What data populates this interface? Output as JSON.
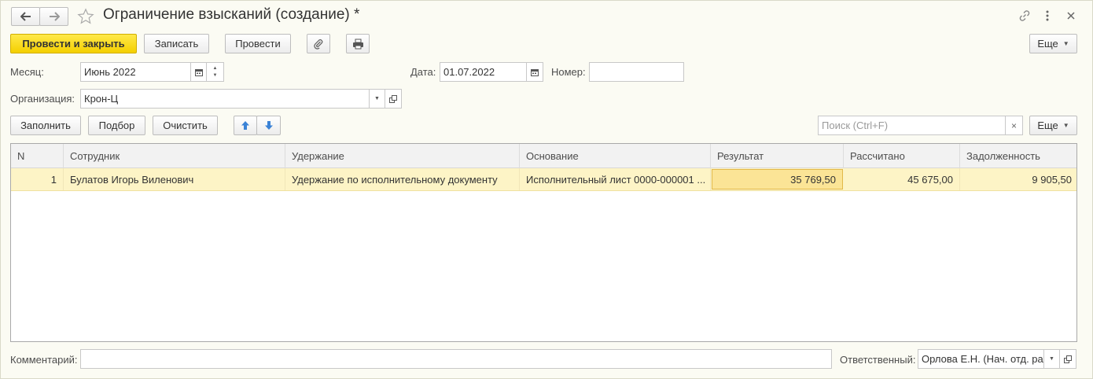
{
  "window": {
    "title": "Ограничение взысканий (создание) *",
    "back_icon": "arrow-left-icon",
    "forward_icon": "arrow-right-icon",
    "favorite_icon": "star-icon",
    "link_icon": "link-icon",
    "menu_icon": "more-vertical-icon",
    "close_icon": "close-icon"
  },
  "toolbar": {
    "post_close": "Провести и закрыть",
    "save": "Записать",
    "post": "Провести",
    "attach_icon": "paperclip-icon",
    "print_icon": "printer-icon",
    "more": "Еще"
  },
  "form": {
    "month_label": "Месяц:",
    "month_value": "Июнь 2022",
    "date_label": "Дата:",
    "date_value": "01.07.2022",
    "number_label": "Номер:",
    "number_value": "",
    "org_label": "Организация:",
    "org_value": "Крон-Ц"
  },
  "table_toolbar": {
    "fill": "Заполнить",
    "select": "Подбор",
    "clear": "Очистить",
    "up_icon": "arrow-up-icon",
    "down_icon": "arrow-down-icon",
    "search_placeholder": "Поиск (Ctrl+F)",
    "more": "Еще"
  },
  "table": {
    "columns": [
      "N",
      "Сотрудник",
      "Удержание",
      "Основание",
      "Результат",
      "Рассчитано",
      "Задолженность"
    ],
    "rows": [
      {
        "n": "1",
        "employee": "Булатов Игорь Виленович",
        "deduction": "Удержание по исполнительному документу",
        "basis": "Исполнительный лист 0000-000001 ...",
        "result": "35 769,50",
        "calculated": "45 675,00",
        "debt": "9 905,50"
      }
    ]
  },
  "footer": {
    "comment_label": "Комментарий:",
    "comment_value": "",
    "responsible_label": "Ответственный:",
    "responsible_value": "Орлова Е.Н. (Нач. отд. ра"
  },
  "colors": {
    "primary_button": "#f4cf00",
    "selected_row": "#fdf4c6",
    "selected_cell": "#fbe496",
    "arrow_blue": "#3a82d6"
  }
}
